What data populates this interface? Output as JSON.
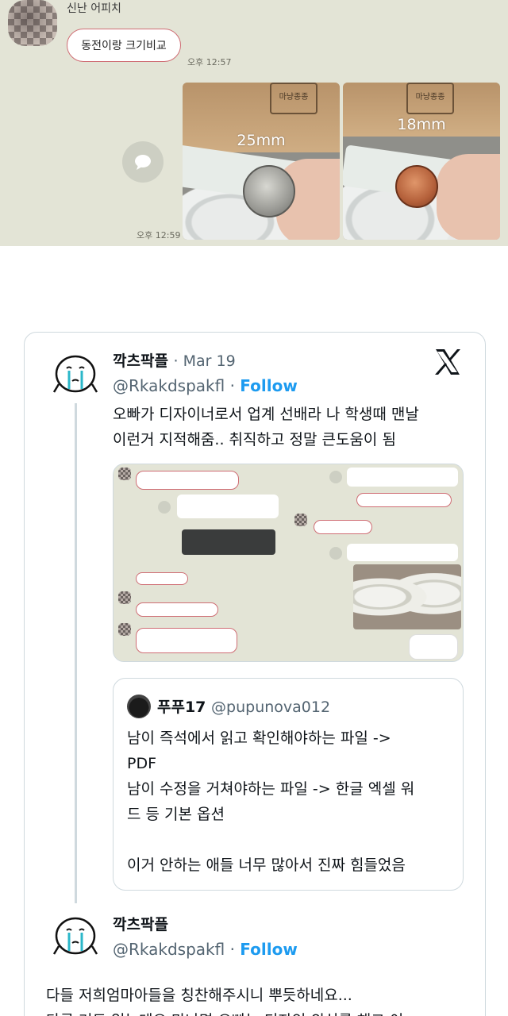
{
  "chat": {
    "sender_name": "신난 어피치",
    "message": "동전이랑 크기비교",
    "time_message": "오후 12:57",
    "time_photos": "오후 12:59",
    "photos": [
      {
        "caption": "25mm",
        "box_label": "마냥종종"
      },
      {
        "caption": "18mm",
        "box_label": "마냥종종"
      }
    ],
    "share_icon": "speech-bubble-icon"
  },
  "tweet": {
    "author_name": "깍츠팍플",
    "date": "· Mar 19",
    "handle": "@Rkakdspakfl",
    "separator": "·",
    "follow_label": "Follow",
    "text_lines": [
      "오빠가 디자이너로서 업계 선배라 나 학생때 맨날",
      "이런거 지적해줌.. 취직하고 정말 큰도움이 됨"
    ],
    "platform_icon": "x-logo-icon",
    "quoted": {
      "author_name": "푸푸17",
      "handle": "@pupunova012",
      "text_lines": [
        "남이 즉석에서 읽고 확인해야하는 파일 ->",
        "PDF",
        "남이 수정을 거쳐야하는 파일 -> 한글 엑셀 워",
        "드 등 기본 옵션",
        "",
        "이거 안하는 애들 너무 많아서 진짜 힘들었음"
      ]
    }
  },
  "reply": {
    "author_name": "깍츠팍플",
    "handle": "@Rkakdspakfl",
    "separator": "·",
    "follow_label": "Follow",
    "text_lines": [
      "다들 저희엄마아들을 칭찬해주시니 뿌듯하네요...",
      "다른 거도 있는데요 만나면 오빠는 디자인 의식를 해그 이"
    ]
  }
}
